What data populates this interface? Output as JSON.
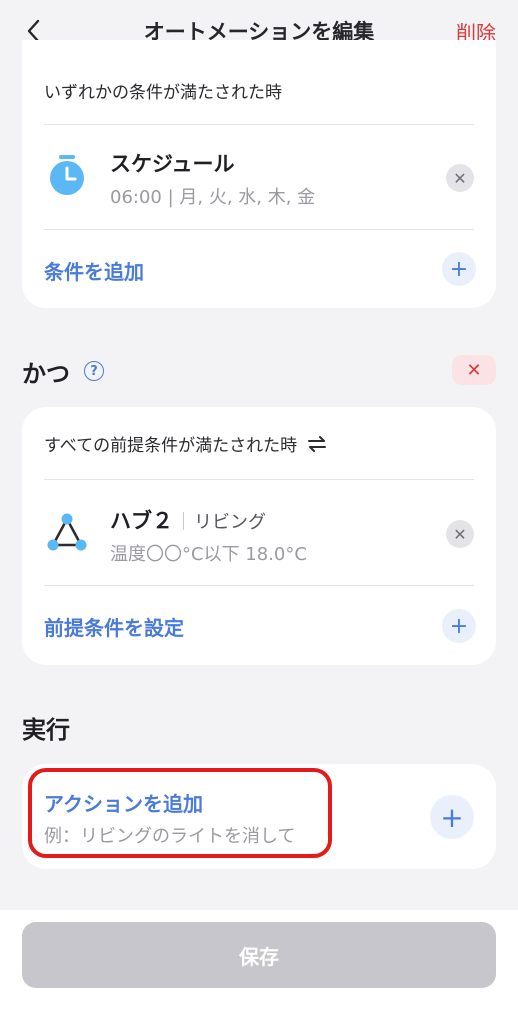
{
  "header": {
    "title": "オートメーションを編集",
    "delete_label": "削除"
  },
  "trigger_card": {
    "heading": "いずれかの条件が満たされた時",
    "items": [
      {
        "icon": "timer-icon",
        "title": "スケジュール",
        "subtitle": "06:00 | 月, 火, 水, 木, 金"
      }
    ],
    "add_label": "条件を追加"
  },
  "and_section": {
    "title": "かつ",
    "help_glyph": "?",
    "card": {
      "heading": "すべての前提条件が満たされた時",
      "heading_icon": "swap-icon",
      "items": [
        {
          "icon": "hub-icon",
          "title": "ハブ２",
          "room": "リビング",
          "subtitle": "温度〇〇°C以下 18.0°C"
        }
      ],
      "add_label": "前提条件を設定"
    }
  },
  "execute_section": {
    "title": "実行",
    "add_label": "アクションを追加",
    "example": "例：リビングのライトを消して"
  },
  "footer": {
    "save_label": "保存"
  },
  "colors": {
    "accent": "#4a7bd9",
    "danger": "#d83a3a",
    "highlight": "#e31b1b",
    "background": "#f3f3f5"
  }
}
